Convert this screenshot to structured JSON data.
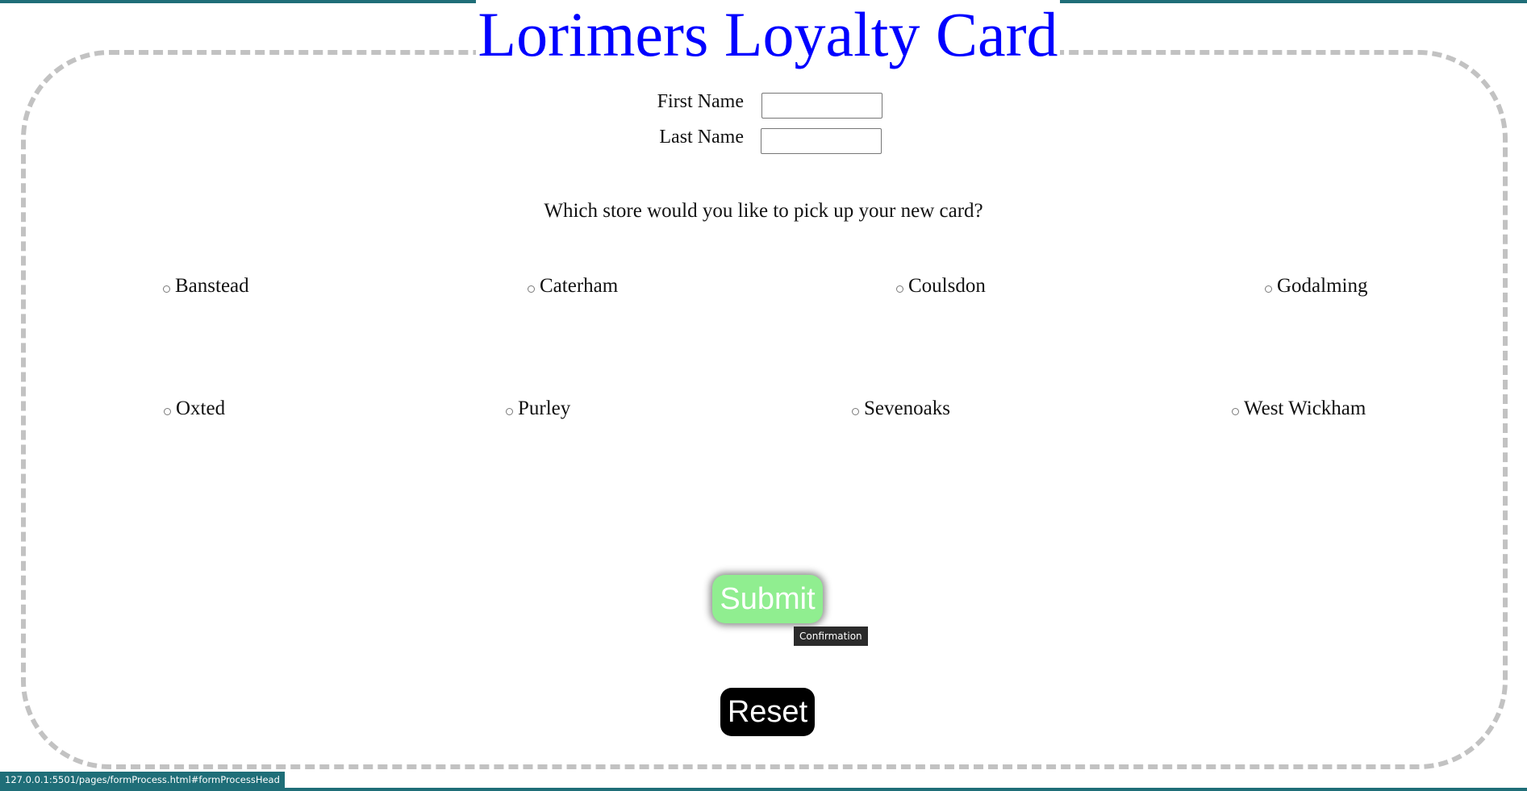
{
  "header": {
    "title": "Lorimers Loyalty Card"
  },
  "form": {
    "first_name_label": "First Name",
    "first_name_value": "",
    "last_name_label": "Last Name",
    "last_name_value": "",
    "store_question": "Which store would you like to pick up your new card?",
    "stores": [
      "Banstead",
      "Caterham",
      "Coulsdon",
      "Godalming",
      "Oxted",
      "Purley",
      "Sevenoaks",
      "West Wickham"
    ],
    "submit_label": "Submit",
    "submit_tooltip": "Confirmation",
    "reset_label": "Reset"
  },
  "status_bar": {
    "url": "127.0.0.1:5501/pages/formProcess.html#formProcessHead"
  },
  "colors": {
    "title": "#0000ff",
    "submit_background": "#90ee90",
    "reset_background": "#000000",
    "frame_border": "#c2c2c2",
    "accent_strip": "#1f6e78"
  }
}
